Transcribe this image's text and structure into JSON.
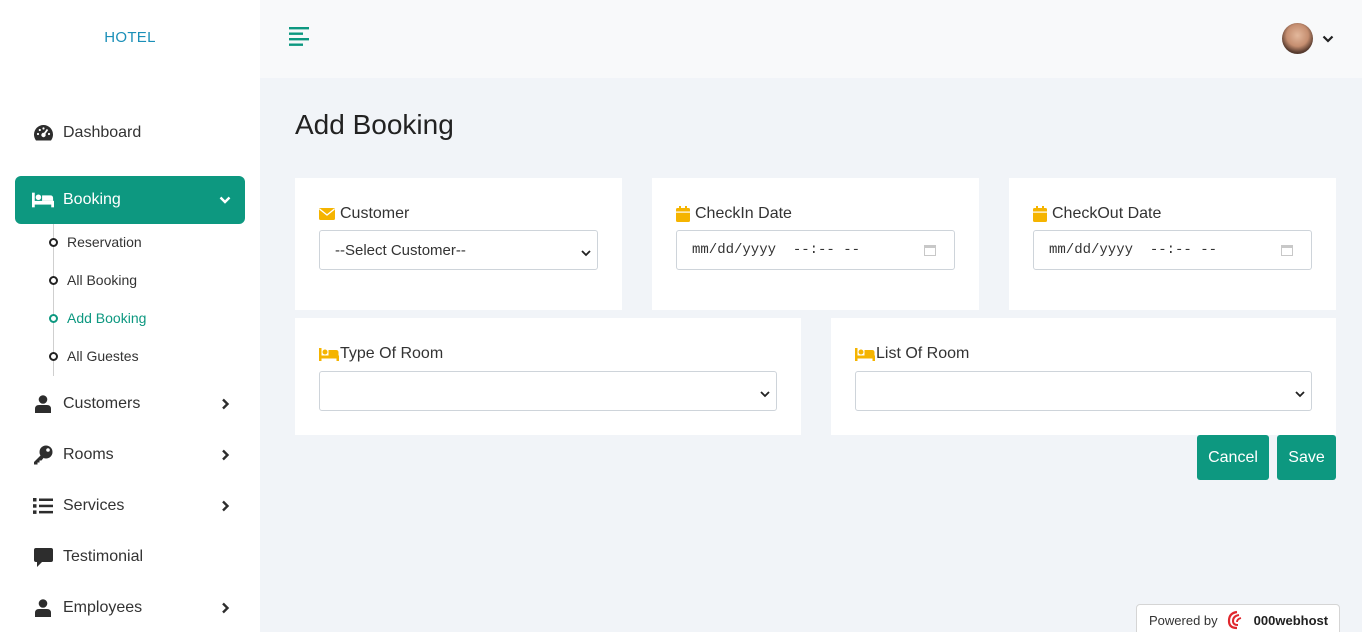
{
  "sidebar": {
    "brand": "HOTEL",
    "items": [
      {
        "label": "Dashboard",
        "icon": "gauge-icon"
      },
      {
        "label": "Booking",
        "icon": "bed-icon",
        "active": true
      },
      {
        "label": "Customers",
        "icon": "user-icon"
      },
      {
        "label": "Rooms",
        "icon": "key-icon"
      },
      {
        "label": "Services",
        "icon": "list-icon"
      },
      {
        "label": "Testimonial",
        "icon": "comment-icon"
      },
      {
        "label": "Employees",
        "icon": "user-icon"
      }
    ],
    "booking_sub": [
      {
        "label": "Reservation"
      },
      {
        "label": "All Booking"
      },
      {
        "label": "Add Booking",
        "current": true
      },
      {
        "label": "All Guestes"
      }
    ]
  },
  "page": {
    "title": "Add Booking"
  },
  "form": {
    "customer": {
      "label": "Customer",
      "value": "--Select Customer--"
    },
    "checkin": {
      "label": "CheckIn Date",
      "placeholder": "mm/dd/yyyy  --:-- --"
    },
    "checkout": {
      "label": "CheckOut Date",
      "placeholder": "mm/dd/yyyy  --:-- --"
    },
    "room_type": {
      "label": "Type Of Room",
      "value": ""
    },
    "room_list": {
      "label": "List Of Room",
      "value": ""
    }
  },
  "buttons": {
    "cancel": "Cancel",
    "save": "Save"
  },
  "footer": {
    "powered_by": "Powered by",
    "host": "000webhost"
  },
  "colors": {
    "accent": "#0d9880",
    "icon_yellow": "#f5b400",
    "brand": "#1a8fb8"
  }
}
